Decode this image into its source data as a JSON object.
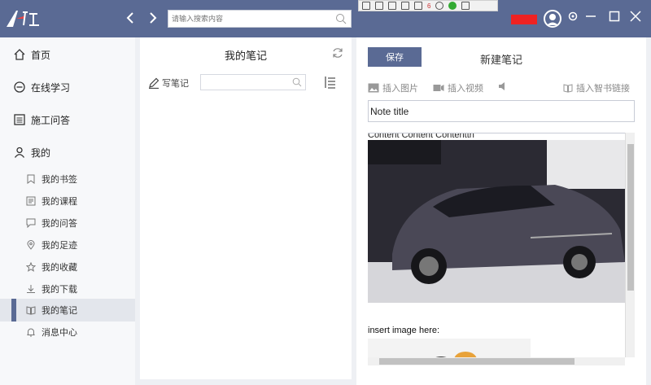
{
  "header": {
    "search_placeholder": "请输入搜索内容",
    "ext_badge": "6",
    "accent": "#5a6a94"
  },
  "sidebar": {
    "items": [
      {
        "label": "首页",
        "icon": "home-icon"
      },
      {
        "label": "在线学习",
        "icon": "minus-circle-icon"
      },
      {
        "label": "施工问答",
        "icon": "list-icon"
      },
      {
        "label": "我的",
        "icon": "person-icon"
      }
    ],
    "sub_items": [
      {
        "label": "我的书签",
        "icon": "bookmark-icon"
      },
      {
        "label": "我的课程",
        "icon": "course-icon"
      },
      {
        "label": "我的问答",
        "icon": "chat-icon"
      },
      {
        "label": "我的足迹",
        "icon": "location-icon"
      },
      {
        "label": "我的收藏",
        "icon": "star-icon"
      },
      {
        "label": "我的下载",
        "icon": "download-icon"
      },
      {
        "label": "我的笔记",
        "icon": "book-icon"
      },
      {
        "label": "消息中心",
        "icon": "bell-icon"
      }
    ]
  },
  "notes_panel": {
    "title": "我的笔记",
    "write_label": "写笔记",
    "search_value": ""
  },
  "editor": {
    "save_label": "保存",
    "title": "新建笔记",
    "toolbar": {
      "insert_image": "插入图片",
      "insert_video": "插入视频",
      "insert_link": "插入智书链接"
    },
    "note_title_value": "Note title",
    "content_text": "Content Content Contenttn",
    "insert_label": "insert image here:"
  }
}
